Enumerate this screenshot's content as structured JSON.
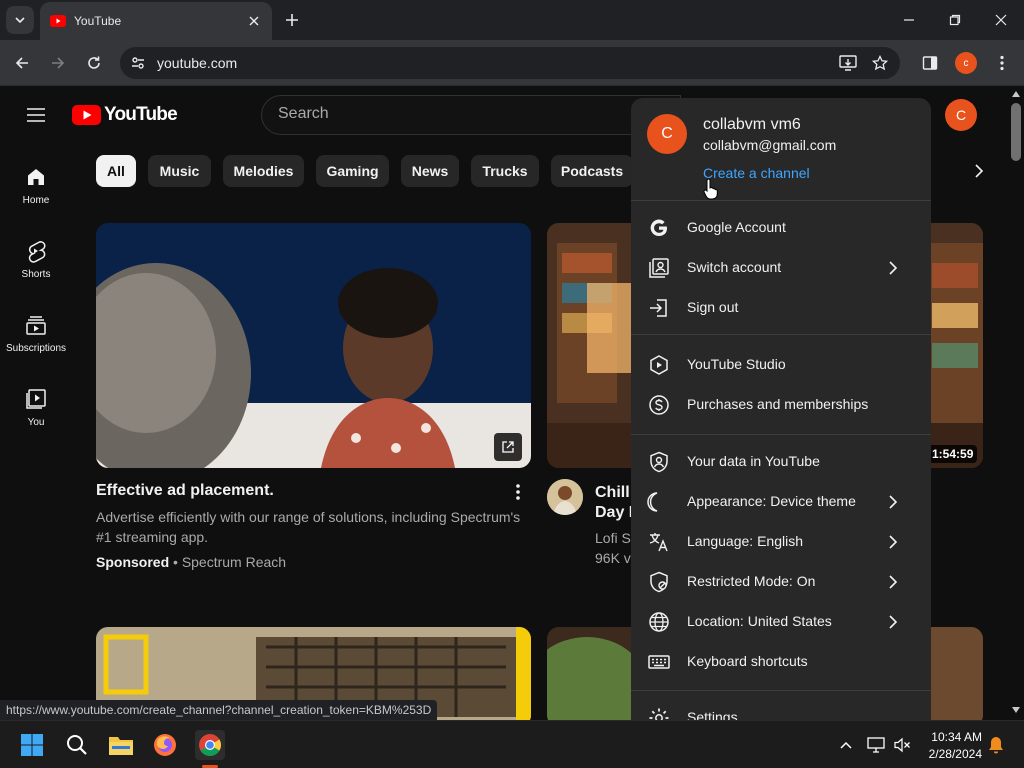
{
  "browser": {
    "tab_title": "YouTube",
    "url": "youtube.com",
    "profile_initial": "c",
    "status_url": "https://www.youtube.com/create_channel?channel_creation_token=KBM%253D"
  },
  "youtube": {
    "logo_text": "YouTube",
    "search_placeholder": "Search",
    "avatar_initial": "C",
    "nav": [
      {
        "label": "Home",
        "icon": "home-icon"
      },
      {
        "label": "Shorts",
        "icon": "shorts-icon"
      },
      {
        "label": "Subscriptions",
        "icon": "subscriptions-icon"
      },
      {
        "label": "You",
        "icon": "you-icon"
      }
    ],
    "chips": [
      "All",
      "Music",
      "Melodies",
      "Gaming",
      "News",
      "Trucks",
      "Podcasts"
    ],
    "videos": {
      "ad": {
        "title": "Effective ad placement.",
        "description": "Advertise efficiently with our range of solutions, including Spectrum's #1 streaming app.",
        "sponsored": "Sponsored",
        "separator": " • ",
        "advertiser": "Spectrum Reach"
      },
      "second": {
        "title_line1": "Chill",
        "title_line2": "Day F",
        "channel": "Lofi S",
        "views": "96K v",
        "duration": "1:54:59"
      }
    }
  },
  "account_menu": {
    "avatar_initial": "C",
    "name": "collabvm vm6",
    "email": "collabvm@gmail.com",
    "create_channel": "Create a channel",
    "items": [
      {
        "label": "Google Account",
        "icon": "google-icon",
        "chevron": false
      },
      {
        "label": "Switch account",
        "icon": "switch-account-icon",
        "chevron": true
      },
      {
        "label": "Sign out",
        "icon": "sign-out-icon",
        "chevron": false
      },
      {
        "label": "YouTube Studio",
        "icon": "youtube-studio-icon",
        "chevron": false
      },
      {
        "label": "Purchases and memberships",
        "icon": "dollar-icon",
        "chevron": false
      },
      {
        "label": "Your data in YouTube",
        "icon": "shield-person-icon",
        "chevron": false
      },
      {
        "label": "Appearance: Device theme",
        "icon": "moon-icon",
        "chevron": true
      },
      {
        "label": "Language: English",
        "icon": "translate-icon",
        "chevron": true
      },
      {
        "label": "Restricted Mode: On",
        "icon": "restricted-icon",
        "chevron": true
      },
      {
        "label": "Location: United States",
        "icon": "globe-icon",
        "chevron": true
      },
      {
        "label": "Keyboard shortcuts",
        "icon": "keyboard-icon",
        "chevron": false
      },
      {
        "label": "Settings",
        "icon": "gear-icon",
        "chevron": false
      }
    ]
  },
  "taskbar": {
    "time": "10:34 AM",
    "date": "2/28/2024"
  },
  "colors": {
    "youtube_red": "#ff0000",
    "avatar_orange": "#e8521c",
    "link_blue": "#3ea6ff"
  }
}
